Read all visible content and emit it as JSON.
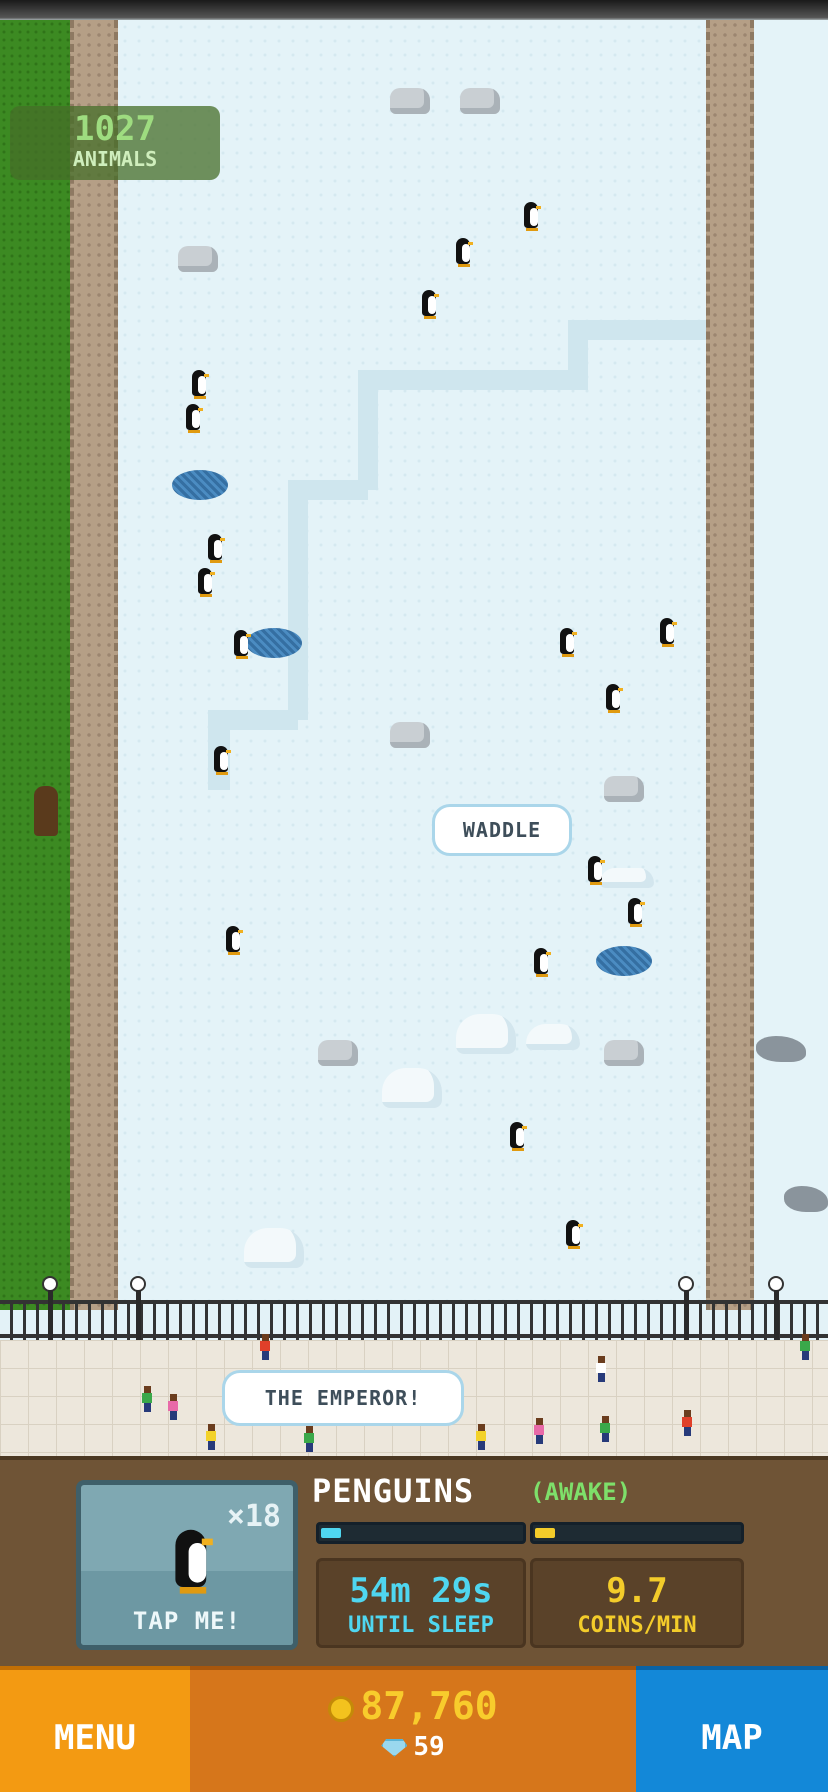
{
  "counter": {
    "value": "1027",
    "label": "ANIMALS"
  },
  "bubbles": {
    "waddle": "WADDLE",
    "emperor": "THE EMPEROR!"
  },
  "animal_card": {
    "count": "×18",
    "tap_label": "TAP ME!",
    "icon": "penguin-icon"
  },
  "species": {
    "name": "PENGUINS",
    "status": "(AWAKE)"
  },
  "progress": {
    "sleep_fraction": 0.1,
    "coins_fraction": 0.1
  },
  "stats": {
    "sleep_value": "54m 29s",
    "sleep_label": "UNTIL SLEEP",
    "coins_value": "9.7",
    "coins_label": "COINS/MIN"
  },
  "bottom": {
    "menu_label": "MENU",
    "coins": "87,760",
    "gems": "59",
    "map_label": "MAP"
  },
  "colors": {
    "menu": "#f39a12",
    "money": "#d6761b",
    "map": "#1388d8",
    "sleep_accent": "#4fd6f0",
    "coins_accent": "#f3cc2a",
    "status_accent": "#7ee06a"
  }
}
